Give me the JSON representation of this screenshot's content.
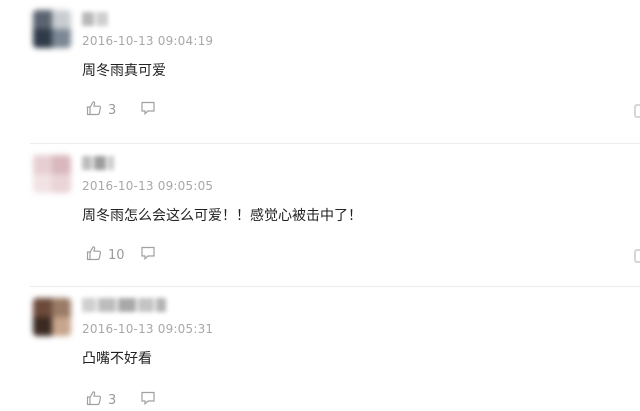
{
  "colors": {
    "text_primary": "#222222",
    "timestamp": "#a8a8a8",
    "icon": "#a0a0a0",
    "divider": "#ececec"
  },
  "comments": [
    {
      "username": "",
      "timestamp": "2016-10-13 09:04:19",
      "content": "周冬雨真可爱",
      "like_count": "3",
      "like_icon": "thumbs-up-icon",
      "reply_icon": "speech-bubble-icon"
    },
    {
      "username": "",
      "timestamp": "2016-10-13 09:05:05",
      "content": "周冬雨怎么会这么可爱！！感觉心被击中了！",
      "like_count": "10",
      "like_icon": "thumbs-up-icon",
      "reply_icon": "speech-bubble-icon"
    },
    {
      "username": "",
      "timestamp": "2016-10-13 09:05:31",
      "content": "凸嘴不好看",
      "like_count": "3",
      "like_icon": "thumbs-up-icon",
      "reply_icon": "speech-bubble-icon"
    }
  ]
}
